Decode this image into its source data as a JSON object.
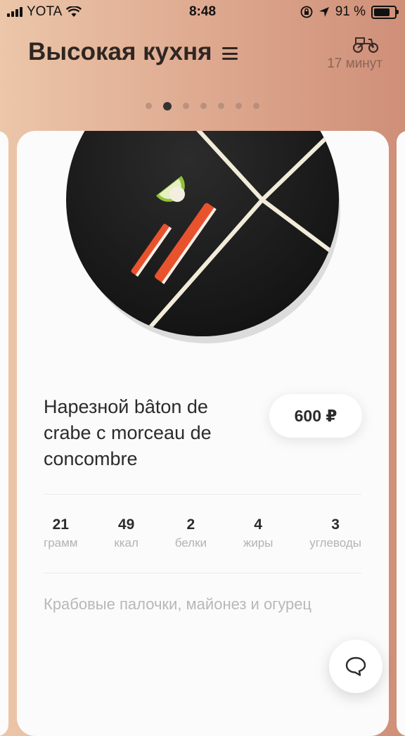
{
  "status_bar": {
    "carrier": "YOTA",
    "time": "8:48",
    "battery_label": "91 %",
    "battery_level": 0.91,
    "icons": [
      "signal-icon",
      "wifi-icon",
      "rotation-lock-icon",
      "location-icon",
      "battery-icon"
    ]
  },
  "header": {
    "title": "Высокая кухня",
    "menu_icon": "hamburger-menu-icon",
    "delivery_icon": "delivery-bike-icon",
    "delivery_time": "17 минут"
  },
  "pager": {
    "total": 7,
    "active_index": 1
  },
  "dish": {
    "name": "Нарезной bâton de crabe c morceau de concombre",
    "price": "600 ₽",
    "stats": [
      {
        "value": "21",
        "label": "грамм"
      },
      {
        "value": "49",
        "label": "ккал"
      },
      {
        "value": "2",
        "label": "белки"
      },
      {
        "value": "4",
        "label": "жиры"
      },
      {
        "value": "3",
        "label": "углеводы"
      }
    ],
    "description": "Крабовые палочки, майонез и огурец"
  },
  "chat_button": {
    "icon": "chat-bubble-icon"
  },
  "colors": {
    "background_start": "#ecc6a9",
    "background_end": "#cf8f78",
    "card": "#fbfbfb",
    "plate": "#1e1e1e",
    "crab": "#e8532e"
  }
}
